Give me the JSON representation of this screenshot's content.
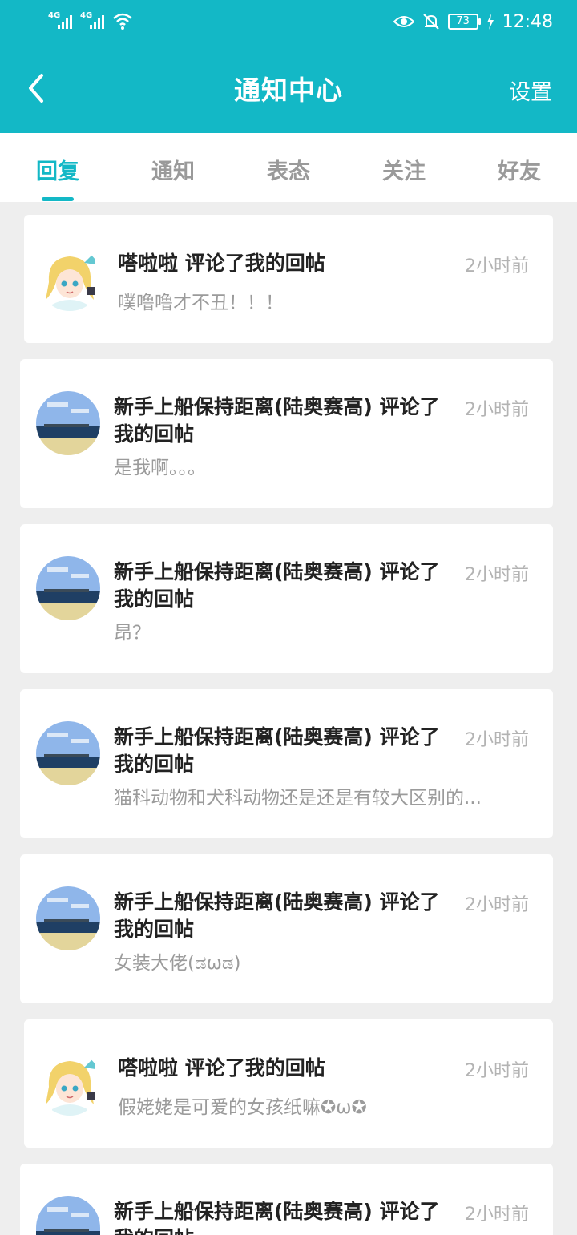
{
  "status_bar": {
    "signal_1": "4G",
    "signal_2": "4G",
    "battery": "73",
    "time": "12:48",
    "icons": [
      "signal-icon",
      "wifi-icon",
      "eye-icon",
      "bell-off-icon",
      "battery-icon",
      "charging-icon"
    ]
  },
  "header": {
    "title": "通知中心",
    "settings_label": "设置",
    "back_icon": "chevron-left-icon",
    "background": "#13b8c6"
  },
  "tabs": [
    {
      "label": "回复",
      "active": true
    },
    {
      "label": "通知",
      "active": false
    },
    {
      "label": "表态",
      "active": false
    },
    {
      "label": "关注",
      "active": false
    },
    {
      "label": "好友",
      "active": false
    }
  ],
  "notifications": [
    {
      "avatar": "anime-girl-avatar",
      "name": "嗒啦啦 评论了我的回帖",
      "message": "噗噜噜才不丑！！！",
      "time": "2小时前"
    },
    {
      "avatar": "seaside-avatar",
      "name": "新手上船保持距离(陆奥赛高) 评论了我的回帖",
      "message": "是我啊。。。",
      "time": "2小时前"
    },
    {
      "avatar": "seaside-avatar",
      "name": "新手上船保持距离(陆奥赛高) 评论了我的回帖",
      "message": "昂？",
      "time": "2小时前"
    },
    {
      "avatar": "seaside-avatar",
      "name": "新手上船保持距离(陆奥赛高) 评论了我的回帖",
      "message": "猫科动物和犬科动物还是还是有较大区别的...",
      "time": "2小时前"
    },
    {
      "avatar": "seaside-avatar",
      "name": "新手上船保持距离(陆奥赛高) 评论了我的回帖",
      "message": "女装大佬(ಡωಡ)",
      "time": "2小时前"
    },
    {
      "avatar": "anime-girl-avatar",
      "name": "嗒啦啦 评论了我的回帖",
      "message": "假姥姥是可爱的女孩纸嘛✪ω✪",
      "time": "2小时前"
    },
    {
      "avatar": "seaside-avatar",
      "name": "新手上船保持距离(陆奥赛高) 评论了我的回帖",
      "message": "",
      "time": "2小时前"
    }
  ]
}
